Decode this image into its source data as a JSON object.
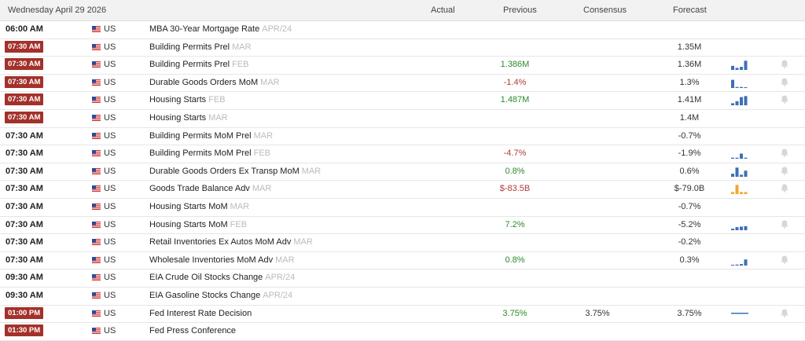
{
  "header": {
    "date": "Wednesday April 29 2026",
    "col_actual": "Actual",
    "col_previous": "Previous",
    "col_consensus": "Consensus",
    "col_forecast": "Forecast"
  },
  "colors": {
    "highlight_time": "#a3312a",
    "positive": "#2a8a2a",
    "negative": "#b23a3a",
    "spark": "#3d6fb6",
    "spark_alt": "#f0a830"
  },
  "rows": [
    {
      "time": "06:00 AM",
      "hi": false,
      "country": "US",
      "event": "MBA 30-Year Mortgage Rate",
      "ref": "APR/24",
      "actual": "",
      "previous": "",
      "prev_class": "",
      "consensus": "",
      "forecast": "",
      "spark": null,
      "bell": false
    },
    {
      "time": "07:30 AM",
      "hi": true,
      "country": "US",
      "event": "Building Permits Prel",
      "ref": "MAR",
      "actual": "",
      "previous": "",
      "prev_class": "",
      "consensus": "",
      "forecast": "1.35M",
      "spark": null,
      "bell": false
    },
    {
      "time": "07:30 AM",
      "hi": true,
      "country": "US",
      "event": "Building Permits Prel",
      "ref": "FEB",
      "actual": "",
      "previous": "1.386M",
      "prev_class": "pos",
      "consensus": "",
      "forecast": "1.36M",
      "spark": [
        0.4,
        0.2,
        0.3,
        0.9
      ],
      "bell": true
    },
    {
      "time": "07:30 AM",
      "hi": true,
      "country": "US",
      "event": "Durable Goods Orders MoM",
      "ref": "MAR",
      "actual": "",
      "previous": "-1.4%",
      "prev_class": "neg",
      "consensus": "",
      "forecast": "1.3%",
      "spark": [
        0.8,
        0.1,
        0.1,
        0.05
      ],
      "bell": true
    },
    {
      "time": "07:30 AM",
      "hi": true,
      "country": "US",
      "event": "Housing Starts",
      "ref": "FEB",
      "actual": "",
      "previous": "1.487M",
      "prev_class": "pos",
      "consensus": "",
      "forecast": "1.41M",
      "spark": [
        0.2,
        0.4,
        0.8,
        0.9
      ],
      "bell": true
    },
    {
      "time": "07:30 AM",
      "hi": true,
      "country": "US",
      "event": "Housing Starts",
      "ref": "MAR",
      "actual": "",
      "previous": "",
      "prev_class": "",
      "consensus": "",
      "forecast": "1.4M",
      "spark": null,
      "bell": false
    },
    {
      "time": "07:30 AM",
      "hi": false,
      "country": "US",
      "event": "Building Permits MoM Prel",
      "ref": "MAR",
      "actual": "",
      "previous": "",
      "prev_class": "",
      "consensus": "",
      "forecast": "-0.7%",
      "spark": null,
      "bell": false
    },
    {
      "time": "07:30 AM",
      "hi": false,
      "country": "US",
      "event": "Building Permits MoM Prel",
      "ref": "FEB",
      "actual": "",
      "previous": "-4.7%",
      "prev_class": "neg",
      "consensus": "",
      "forecast": "-1.9%",
      "spark": [
        0.1,
        0.1,
        0.5,
        0.1
      ],
      "bell": true
    },
    {
      "time": "07:30 AM",
      "hi": false,
      "country": "US",
      "event": "Durable Goods Orders Ex Transp MoM",
      "ref": "MAR",
      "actual": "",
      "previous": "0.8%",
      "prev_class": "pos",
      "consensus": "",
      "forecast": "0.6%",
      "spark": [
        0.3,
        0.9,
        0.2,
        0.6
      ],
      "bell": true
    },
    {
      "time": "07:30 AM",
      "hi": false,
      "country": "US",
      "event": "Goods Trade Balance Adv",
      "ref": "MAR",
      "actual": "",
      "previous": "$-83.5B",
      "prev_class": "neg",
      "consensus": "",
      "forecast": "$-79.0B",
      "spark": [
        0.2,
        0.9,
        0.2,
        0.2
      ],
      "bell": true
    },
    {
      "time": "07:30 AM",
      "hi": false,
      "country": "US",
      "event": "Housing Starts MoM",
      "ref": "MAR",
      "actual": "",
      "previous": "",
      "prev_class": "",
      "consensus": "",
      "forecast": "-0.7%",
      "spark": null,
      "bell": false
    },
    {
      "time": "07:30 AM",
      "hi": false,
      "country": "US",
      "event": "Housing Starts MoM",
      "ref": "FEB",
      "actual": "",
      "previous": "7.2%",
      "prev_class": "pos",
      "consensus": "",
      "forecast": "-5.2%",
      "spark": [
        0.15,
        0.3,
        0.35,
        0.4
      ],
      "bell": true
    },
    {
      "time": "07:30 AM",
      "hi": false,
      "country": "US",
      "event": "Retail Inventories Ex Autos MoM Adv",
      "ref": "MAR",
      "actual": "",
      "previous": "",
      "prev_class": "",
      "consensus": "",
      "forecast": "-0.2%",
      "spark": null,
      "bell": false
    },
    {
      "time": "07:30 AM",
      "hi": false,
      "country": "US",
      "event": "Wholesale Inventories MoM Adv",
      "ref": "MAR",
      "actual": "",
      "previous": "0.8%",
      "prev_class": "pos",
      "consensus": "",
      "forecast": "0.3%",
      "spark": [
        0.05,
        0.1,
        0.15,
        0.6
      ],
      "bell": true
    },
    {
      "time": "09:30 AM",
      "hi": false,
      "country": "US",
      "event": "EIA Crude Oil Stocks Change",
      "ref": "APR/24",
      "actual": "",
      "previous": "",
      "prev_class": "",
      "consensus": "",
      "forecast": "",
      "spark": null,
      "bell": false
    },
    {
      "time": "09:30 AM",
      "hi": false,
      "country": "US",
      "event": "EIA Gasoline Stocks Change",
      "ref": "APR/24",
      "actual": "",
      "previous": "",
      "prev_class": "",
      "consensus": "",
      "forecast": "",
      "spark": null,
      "bell": false
    },
    {
      "time": "01:00 PM",
      "hi": true,
      "country": "US",
      "event": "Fed Interest Rate Decision",
      "ref": "",
      "actual": "",
      "previous": "3.75%",
      "prev_class": "pos",
      "consensus": "3.75%",
      "forecast": "3.75%",
      "spark": "flat",
      "bell": true
    },
    {
      "time": "01:30 PM",
      "hi": true,
      "country": "US",
      "event": "Fed Press Conference",
      "ref": "",
      "actual": "",
      "previous": "",
      "prev_class": "",
      "consensus": "",
      "forecast": "",
      "spark": null,
      "bell": false
    }
  ]
}
